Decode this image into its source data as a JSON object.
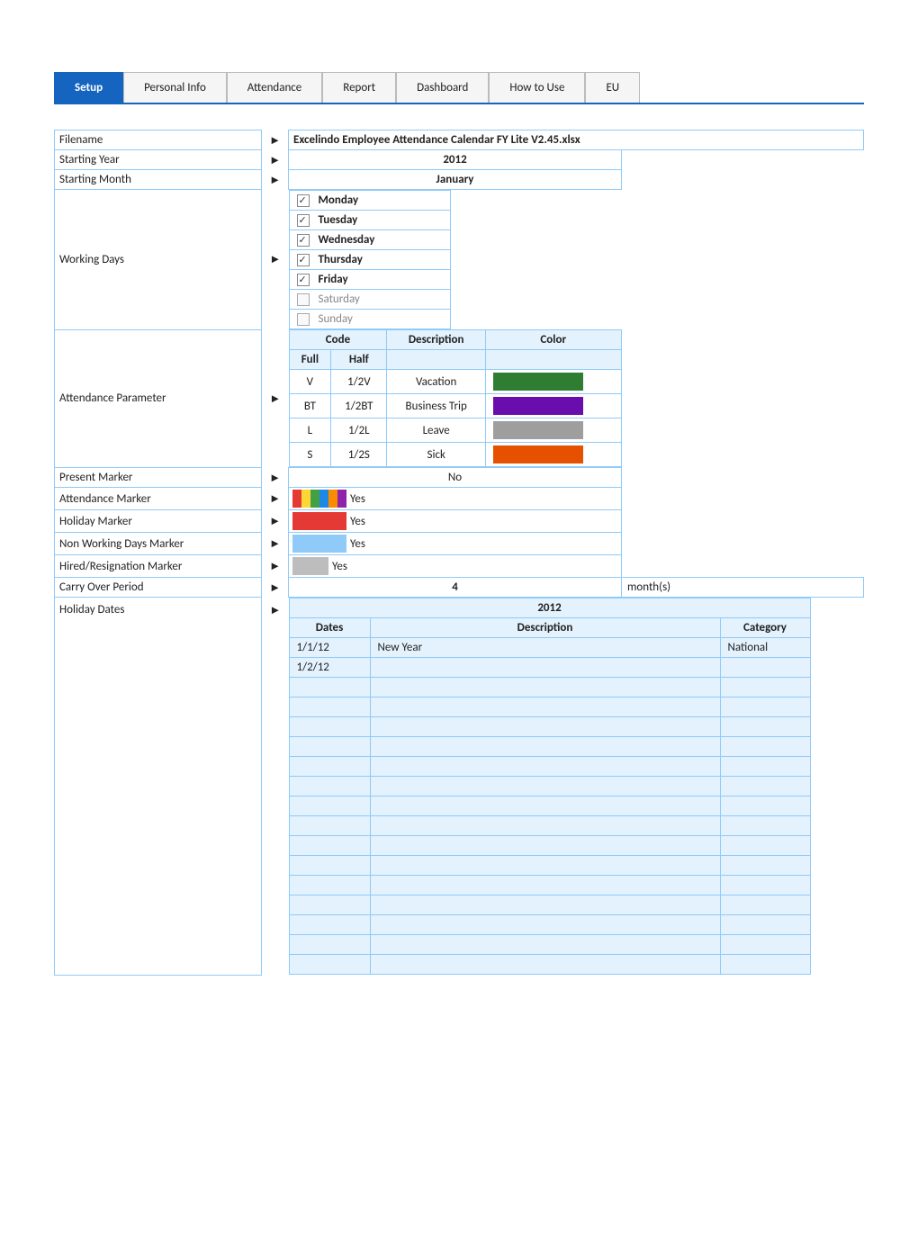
{
  "tabs": [
    {
      "label": "Setup",
      "active": true
    },
    {
      "label": "Personal Info",
      "active": false
    },
    {
      "label": "Attendance",
      "active": false
    },
    {
      "label": "Report",
      "active": false
    },
    {
      "label": "Dashboard",
      "active": false
    },
    {
      "label": "How to Use",
      "active": false
    },
    {
      "label": "EU",
      "active": false
    }
  ],
  "rows": {
    "filename_label": "Filename",
    "filename_value": "Excelindo Employee Attendance Calendar FY Lite V2.45.xlsx",
    "starting_year_label": "Starting Year",
    "starting_year_value": "2012",
    "starting_month_label": "Starting Month",
    "starting_month_value": "January",
    "working_days_label": "Working Days",
    "working_days": [
      {
        "day": "Monday",
        "checked": true
      },
      {
        "day": "Tuesday",
        "checked": true
      },
      {
        "day": "Wednesday",
        "checked": true
      },
      {
        "day": "Thursday",
        "checked": true
      },
      {
        "day": "Friday",
        "checked": true
      },
      {
        "day": "Saturday",
        "checked": false
      },
      {
        "day": "Sunday",
        "checked": false
      }
    ],
    "att_param_label": "Attendance Parameter",
    "att_param_header_code": "Code",
    "att_param_header_full": "Full",
    "att_param_header_half": "Half",
    "att_param_header_desc": "Description",
    "att_param_header_color": "Color",
    "att_params": [
      {
        "full": "V",
        "half": "1/2V",
        "desc": "Vacation",
        "color": "green"
      },
      {
        "full": "BT",
        "half": "1/2BT",
        "desc": "Business Trip",
        "color": "purple"
      },
      {
        "full": "L",
        "half": "1/2L",
        "desc": "Leave",
        "color": "gray"
      },
      {
        "full": "S",
        "half": "1/2S",
        "desc": "Sick",
        "color": "orange"
      }
    ],
    "present_marker_label": "Present Marker",
    "present_marker_value": "No",
    "attendance_marker_label": "Attendance Marker",
    "attendance_marker_value": "Yes",
    "holiday_marker_label": "Holiday Marker",
    "holiday_marker_value": "Yes",
    "nonworking_marker_label": "Non Working Days Marker",
    "nonworking_marker_value": "Yes",
    "hired_marker_label": "Hired/Resignation Marker",
    "hired_marker_value": "Yes",
    "carry_over_label": "Carry Over Period",
    "carry_over_num": "4",
    "carry_over_unit": "month(s)",
    "holiday_dates_label": "Holiday Dates",
    "holiday_year": "2012",
    "holiday_header_dates": "Dates",
    "holiday_header_desc": "Description",
    "holiday_header_cat": "Category",
    "holiday_rows": [
      {
        "date": "1/1/12",
        "desc": "New Year",
        "cat": "National"
      },
      {
        "date": "1/2/12",
        "desc": "",
        "cat": ""
      },
      {
        "date": "",
        "desc": "",
        "cat": ""
      },
      {
        "date": "",
        "desc": "",
        "cat": ""
      },
      {
        "date": "",
        "desc": "",
        "cat": ""
      },
      {
        "date": "",
        "desc": "",
        "cat": ""
      },
      {
        "date": "",
        "desc": "",
        "cat": ""
      },
      {
        "date": "",
        "desc": "",
        "cat": ""
      },
      {
        "date": "",
        "desc": "",
        "cat": ""
      },
      {
        "date": "",
        "desc": "",
        "cat": ""
      },
      {
        "date": "",
        "desc": "",
        "cat": ""
      },
      {
        "date": "",
        "desc": "",
        "cat": ""
      },
      {
        "date": "",
        "desc": "",
        "cat": ""
      },
      {
        "date": "",
        "desc": "",
        "cat": ""
      },
      {
        "date": "",
        "desc": "",
        "cat": ""
      },
      {
        "date": "",
        "desc": "",
        "cat": ""
      },
      {
        "date": "",
        "desc": "",
        "cat": ""
      }
    ]
  }
}
